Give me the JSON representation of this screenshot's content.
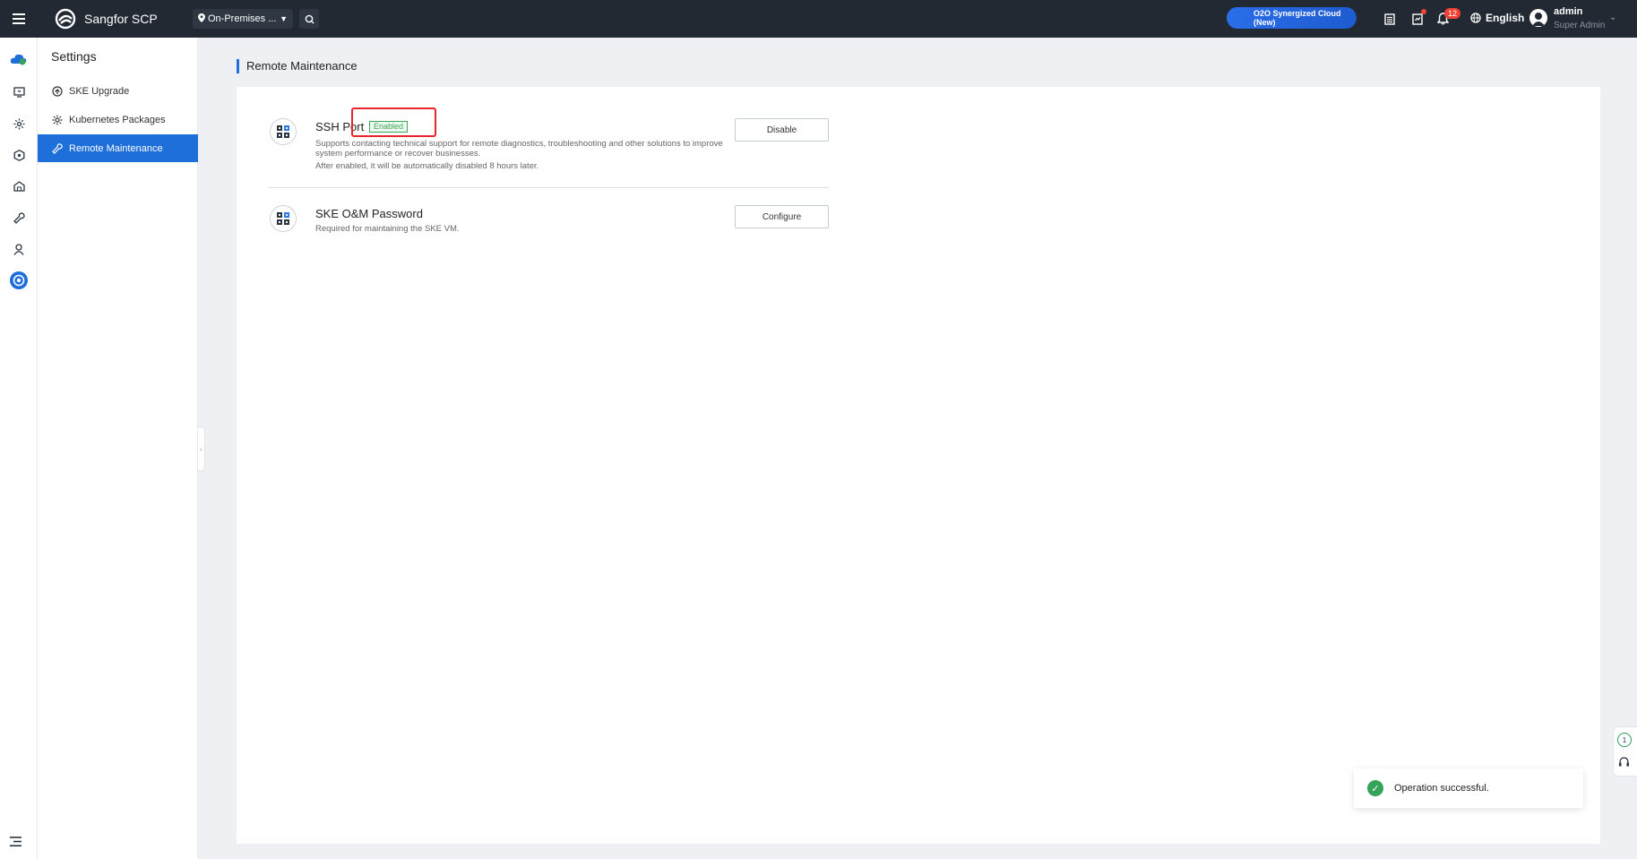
{
  "topbar": {
    "brand": "Sangfor SCP",
    "location": "On-Premises ...",
    "cloud_button": "O2O Synergized Cloud (New)",
    "notification_count": "12",
    "language": "English",
    "user": {
      "name": "admin",
      "role": "Super Admin"
    }
  },
  "sidebar": {
    "title": "Settings",
    "items": [
      {
        "label": "SKE Upgrade"
      },
      {
        "label": "Kubernetes Packages"
      },
      {
        "label": "Remote Maintenance"
      }
    ]
  },
  "main": {
    "breadcrumb": "Remote Maintenance",
    "features": [
      {
        "title": "SSH Port",
        "tag": "Enabled",
        "desc_line1": "Supports contacting technical support for remote diagnostics, troubleshooting and other solutions to improve system performance or recover businesses.",
        "desc_line2": "After enabled, it will be automatically disabled 8 hours later.",
        "button": "Disable"
      },
      {
        "title": "SKE O&M Password",
        "desc_line1": "Required for maintaining the SKE VM.",
        "button": "Configure"
      }
    ]
  },
  "toast": {
    "message": "Operation successful."
  },
  "float_helper": {
    "count": "1"
  },
  "colors": {
    "topbar": "#222933",
    "accent": "#1f6fdb",
    "success": "#35a35a",
    "highlight": "#e6262c"
  }
}
